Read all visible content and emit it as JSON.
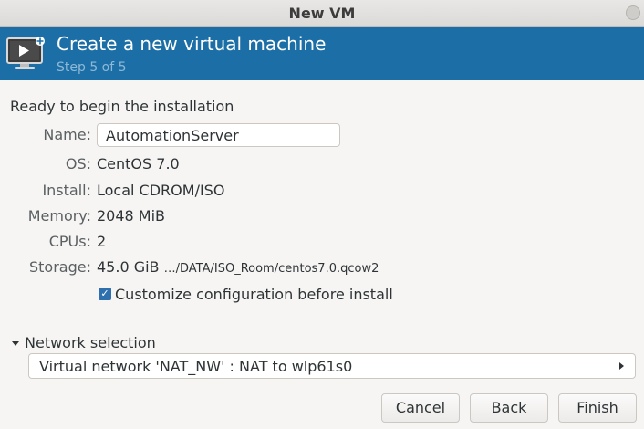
{
  "window": {
    "title": "New VM"
  },
  "banner": {
    "title": "Create a new virtual machine",
    "subtitle": "Step 5 of 5",
    "icon": "monitor-play-icon"
  },
  "summary": {
    "heading": "Ready to begin the installation",
    "name_label": "Name:",
    "name_value": "AutomationServer",
    "os_label": "OS:",
    "os_value": "CentOS 7.0",
    "install_label": "Install:",
    "install_value": "Local CDROM/ISO",
    "memory_label": "Memory:",
    "memory_value": "2048 MiB",
    "cpus_label": "CPUs:",
    "cpus_value": "2",
    "storage_label": "Storage:",
    "storage_size": "45.0 GiB",
    "storage_path": "…/DATA/ISO_Room/centos7.0.qcow2"
  },
  "customize": {
    "label": "Customize configuration before install",
    "checked": true
  },
  "network": {
    "expander_label": "Network selection",
    "selected": "Virtual network 'NAT_NW' : NAT to wlp61s0"
  },
  "buttons": {
    "cancel": "Cancel",
    "back": "Back",
    "finish": "Finish"
  },
  "colors": {
    "banner": "#1c6fa6",
    "accent": "#2e6fae"
  }
}
